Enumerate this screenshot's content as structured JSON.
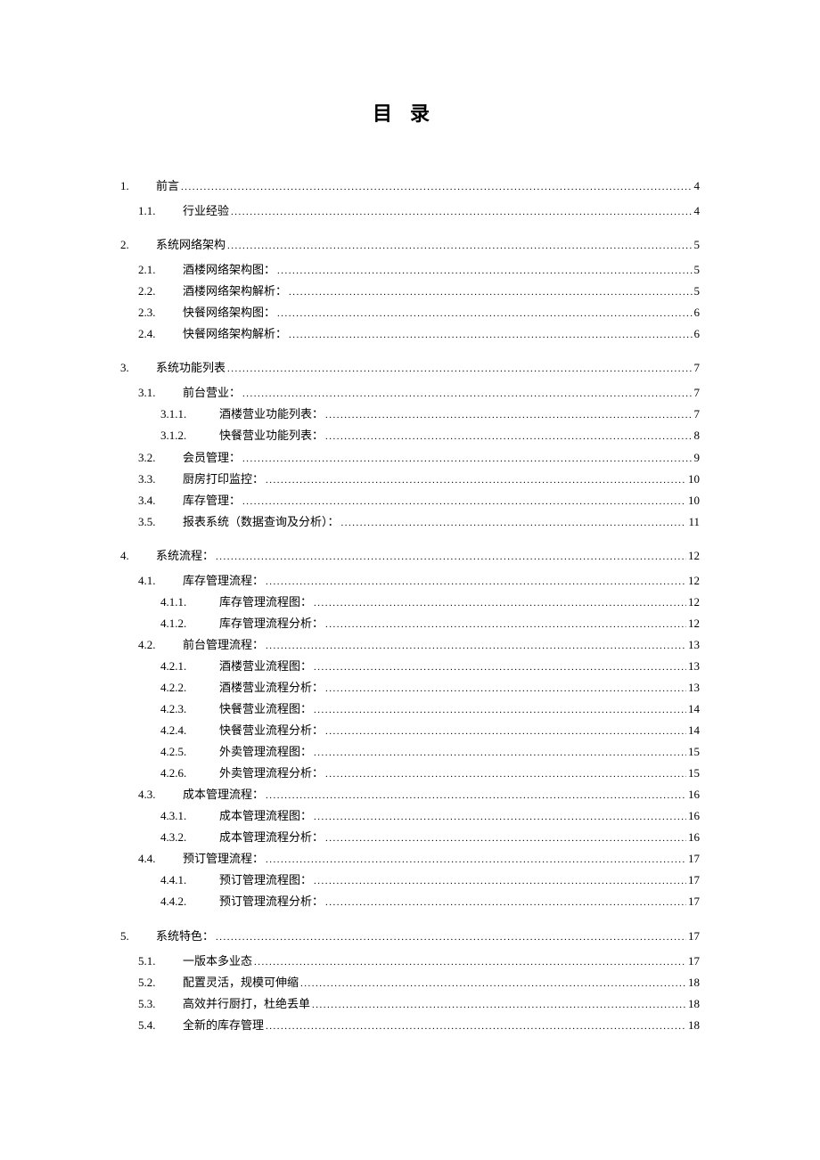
{
  "title": "目录",
  "toc": [
    {
      "level": 1,
      "num": "1.",
      "text": "前言",
      "page": "4"
    },
    {
      "level": 2,
      "num": "1.1.",
      "text": "行业经验",
      "page": "4"
    },
    {
      "level": 1,
      "num": "2.",
      "text": "系统网络架构",
      "page": "5"
    },
    {
      "level": 2,
      "num": "2.1.",
      "text": "酒楼网络架构图：",
      "page": "5"
    },
    {
      "level": 2,
      "num": "2.2.",
      "text": "酒楼网络架构解析：",
      "page": "5"
    },
    {
      "level": 2,
      "num": "2.3.",
      "text": "快餐网络架构图：",
      "page": "6"
    },
    {
      "level": 2,
      "num": "2.4.",
      "text": "快餐网络架构解析：",
      "page": "6"
    },
    {
      "level": 1,
      "num": "3.",
      "text": "系统功能列表",
      "page": "7"
    },
    {
      "level": 2,
      "num": "3.1.",
      "text": "前台营业：",
      "page": "7"
    },
    {
      "level": 3,
      "num": "3.1.1.",
      "text": "酒楼营业功能列表：",
      "page": "7"
    },
    {
      "level": 3,
      "num": "3.1.2.",
      "text": "快餐营业功能列表：",
      "page": "8"
    },
    {
      "level": 2,
      "num": "3.2.",
      "text": "会员管理：",
      "page": "9"
    },
    {
      "level": 2,
      "num": "3.3.",
      "text": "厨房打印监控：",
      "page": "10"
    },
    {
      "level": 2,
      "num": "3.4.",
      "text": "库存管理：",
      "page": "10"
    },
    {
      "level": 2,
      "num": "3.5.",
      "text": "报表系统（数据查询及分析）：",
      "page": "11"
    },
    {
      "level": 1,
      "num": "4.",
      "text": "系统流程：",
      "page": "12"
    },
    {
      "level": 2,
      "num": "4.1.",
      "text": "库存管理流程：",
      "page": "12"
    },
    {
      "level": 3,
      "num": "4.1.1.",
      "text": "库存管理流程图：",
      "page": "12"
    },
    {
      "level": 3,
      "num": "4.1.2.",
      "text": "库存管理流程分析：",
      "page": "12"
    },
    {
      "level": 2,
      "num": "4.2.",
      "text": "前台管理流程：",
      "page": "13"
    },
    {
      "level": 3,
      "num": "4.2.1.",
      "text": "酒楼营业流程图：",
      "page": "13"
    },
    {
      "level": 3,
      "num": "4.2.2.",
      "text": "酒楼营业流程分析：",
      "page": "13"
    },
    {
      "level": 3,
      "num": "4.2.3.",
      "text": "快餐营业流程图：",
      "page": "14"
    },
    {
      "level": 3,
      "num": "4.2.4.",
      "text": "快餐营业流程分析：",
      "page": "14"
    },
    {
      "level": 3,
      "num": "4.2.5.",
      "text": "外卖管理流程图：",
      "page": "15"
    },
    {
      "level": 3,
      "num": "4.2.6.",
      "text": "外卖管理流程分析：",
      "page": "15"
    },
    {
      "level": 2,
      "num": "4.3.",
      "text": "成本管理流程：",
      "page": "16"
    },
    {
      "level": 3,
      "num": "4.3.1.",
      "text": "成本管理流程图：",
      "page": "16"
    },
    {
      "level": 3,
      "num": "4.3.2.",
      "text": "成本管理流程分析：",
      "page": "16"
    },
    {
      "level": 2,
      "num": "4.4.",
      "text": "预订管理流程：",
      "page": "17"
    },
    {
      "level": 3,
      "num": "4.4.1.",
      "text": "预订管理流程图：",
      "page": "17"
    },
    {
      "level": 3,
      "num": "4.4.2.",
      "text": "预订管理流程分析：",
      "page": "17"
    },
    {
      "level": 1,
      "num": "5.",
      "text": "系统特色：",
      "page": "17"
    },
    {
      "level": 2,
      "num": "5.1.",
      "text": "一版本多业态",
      "page": "17"
    },
    {
      "level": 2,
      "num": "5.2.",
      "text": "配置灵活，规模可伸缩",
      "page": "18"
    },
    {
      "level": 2,
      "num": "5.3.",
      "text": "高效并行厨打，杜绝丢单",
      "page": "18"
    },
    {
      "level": 2,
      "num": "5.4.",
      "text": "全新的库存管理",
      "page": "18"
    }
  ]
}
